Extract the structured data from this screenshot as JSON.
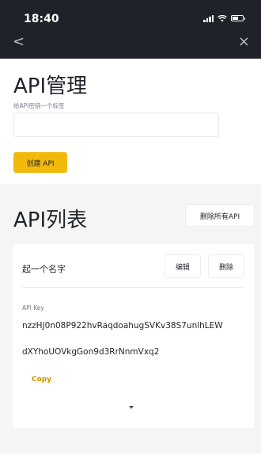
{
  "status": {
    "time": "18:40"
  },
  "nav": {
    "back_glyph": "<",
    "close_glyph": "×"
  },
  "header": {
    "title": "API管理"
  },
  "label_form": {
    "label": "给API密钥一个标签",
    "value": "",
    "create_button": "创建 API"
  },
  "api_list": {
    "title": "API列表",
    "delete_all_button": "删除所有API",
    "items": [
      {
        "name": "起一个名字",
        "edit_button": "编辑",
        "delete_button": "删除",
        "key_label": "API Key",
        "key_line1": "nzzHJ0n08P922hvRaqdoahugSVKv38S7unlhLEW",
        "key_line2": "dXYhoUOVkgGon9d3RrNnmVxq2",
        "copy_label": "Copy"
      }
    ]
  },
  "colors": {
    "accent": "#f0b90b",
    "link": "#c99400",
    "header_bg": "#1f2329",
    "list_bg": "#f5f5f5"
  }
}
